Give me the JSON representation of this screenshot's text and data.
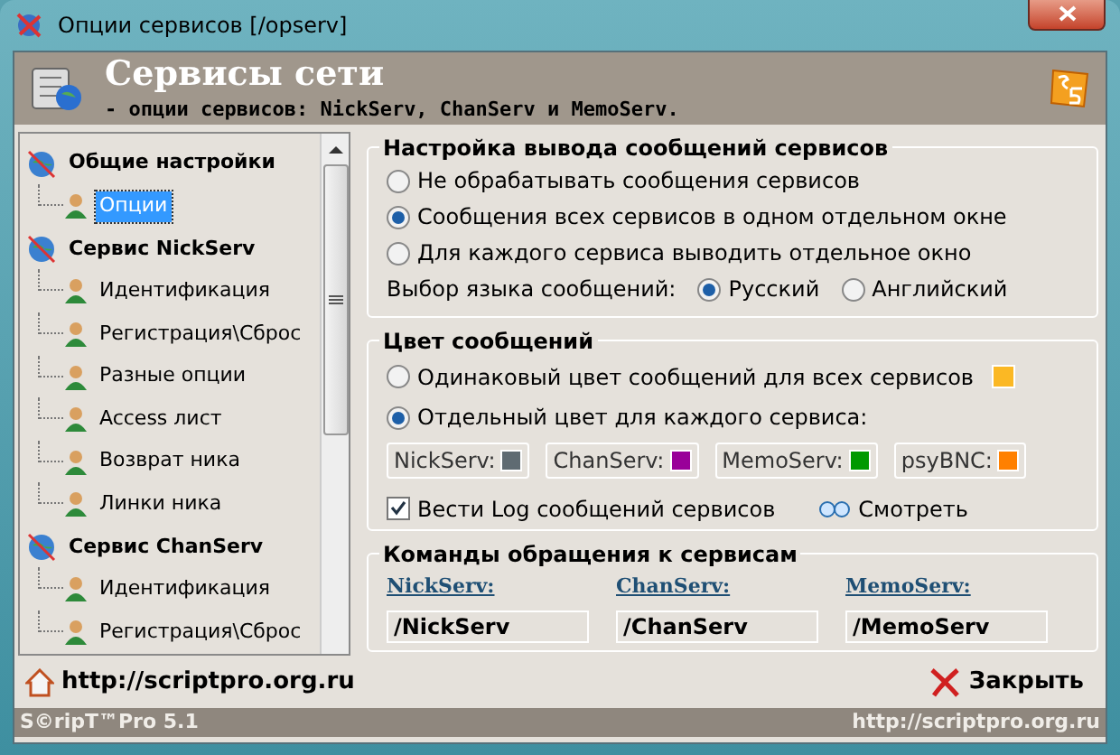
{
  "window": {
    "title": "Опции сервисов [/opserv]"
  },
  "header": {
    "title": "Сервисы сети",
    "subtitle": "- опции сервисов: NickServ, ChanServ и MemoServ."
  },
  "tree": [
    {
      "label": "Общие настройки",
      "selected": false,
      "children": [
        {
          "label": "Опции",
          "selected": true
        }
      ]
    },
    {
      "label": "Сервис NickServ",
      "selected": false,
      "children": [
        {
          "label": "Идентификация",
          "selected": false
        },
        {
          "label": "Регистрация\\Сброс",
          "selected": false
        },
        {
          "label": "Разные опции",
          "selected": false
        },
        {
          "label": "Access лист",
          "selected": false
        },
        {
          "label": "Возврат ника",
          "selected": false
        },
        {
          "label": "Линки ника",
          "selected": false
        }
      ]
    },
    {
      "label": "Сервис ChanServ",
      "selected": false,
      "children": [
        {
          "label": "Идентификация",
          "selected": false
        },
        {
          "label": "Регистрация\\Сброс",
          "selected": false
        }
      ]
    }
  ],
  "output": {
    "title": "Настройка вывода сообщений сервисов",
    "options": [
      {
        "label": "Не обрабатывать сообщения сервисов",
        "selected": false
      },
      {
        "label": "Сообщения всех сервисов в одном отдельном окне",
        "selected": true
      },
      {
        "label": "Для каждого сервиса выводить отдельное окно",
        "selected": false
      }
    ],
    "language": {
      "label": "Выбор языка сообщений:",
      "options": [
        {
          "label": "Русский",
          "selected": true
        },
        {
          "label": "Английский",
          "selected": false
        }
      ]
    }
  },
  "colors": {
    "title": "Цвет сообщений",
    "options": [
      {
        "label": "Одинаковый цвет сообщений для всех сервисов",
        "selected": false,
        "color": "#fbb824"
      },
      {
        "label": "Отдельный цвет для каждого сервиса:",
        "selected": true
      }
    ],
    "services": [
      {
        "label": "NickServ:",
        "color": "#5f6b72"
      },
      {
        "label": "ChanServ:",
        "color": "#990099"
      },
      {
        "label": "MemoServ:",
        "color": "#009900"
      },
      {
        "label": "psyBNC:",
        "color": "#ff8000"
      }
    ],
    "log": {
      "label": "Вести Log сообщений сервисов",
      "checked": true
    },
    "view": "Смотреть"
  },
  "commands": {
    "title": "Команды обращения к сервисам",
    "items": [
      {
        "label": "NickServ:",
        "value": "/NickServ"
      },
      {
        "label": "ChanServ:",
        "value": "/ChanServ"
      },
      {
        "label": "MemoServ:",
        "value": "/MemoServ"
      }
    ]
  },
  "footer": {
    "link": "http://scriptpro.org.ru",
    "close": "Закрыть"
  },
  "status_bar": {
    "left": "S©ripT™Pro 5.1",
    "right": "http://scriptpro.org.ru"
  }
}
